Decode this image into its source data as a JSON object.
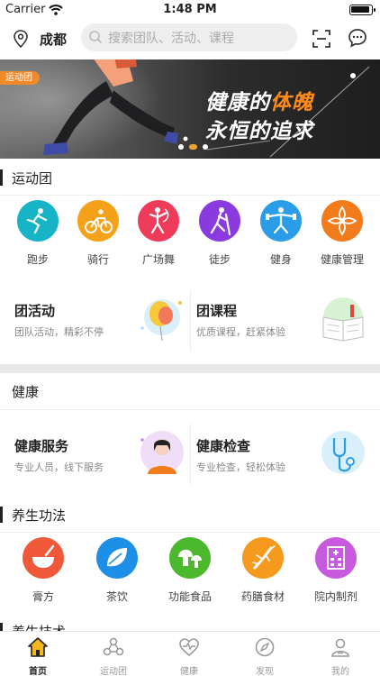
{
  "status_bar": {
    "carrier": "Carrier",
    "time": "1:48 PM"
  },
  "header": {
    "city": "成都",
    "search_placeholder": "搜索团队、活动、课程",
    "icons": [
      "location-icon",
      "search-icon",
      "scan-icon",
      "message-icon"
    ]
  },
  "banner": {
    "tag": "运动团",
    "line1_a": "健康的",
    "line1_b": "体魄",
    "line2": "永恒的追求",
    "accent_color": "#ff8a1c",
    "slide_count": 3,
    "active_slide": 2
  },
  "sections": {
    "sports": {
      "title": "运动团",
      "items": [
        {
          "label": "跑步",
          "icon": "running-icon",
          "color": "#16b4c6"
        },
        {
          "label": "骑行",
          "icon": "cycling-icon",
          "color": "#f5a21a"
        },
        {
          "label": "广场舞",
          "icon": "square-dance-icon",
          "color": "#ee3b5a"
        },
        {
          "label": "徒步",
          "icon": "hiking-icon",
          "color": "#8a3be0"
        },
        {
          "label": "健身",
          "icon": "fitness-icon",
          "color": "#2b9de8"
        },
        {
          "label": "健康管理",
          "icon": "health-management-icon",
          "color": "#f27b1c"
        }
      ],
      "cards": [
        {
          "title": "团活动",
          "subtitle": "团队活动，精彩不停"
        },
        {
          "title": "团课程",
          "subtitle": "优质课程，赶紧体验"
        }
      ]
    },
    "health": {
      "title": "健康",
      "cards": [
        {
          "title": "健康服务",
          "subtitle": "专业人员，线下服务"
        },
        {
          "title": "健康检查",
          "subtitle": "专业检查，轻松体验"
        }
      ]
    },
    "wellness": {
      "title": "养生功法",
      "items": [
        {
          "label": "膏方",
          "icon": "ointment-bowl-icon",
          "color": "#f0583a"
        },
        {
          "label": "茶饮",
          "icon": "tea-leaf-icon",
          "color": "#1e8fe6"
        },
        {
          "label": "功能食品",
          "icon": "mushroom-icon",
          "color": "#4bb82e"
        },
        {
          "label": "药膳食材",
          "icon": "ginseng-icon",
          "color": "#f59a1e"
        },
        {
          "label": "院内制剂",
          "icon": "hospital-icon",
          "color": "#c85ae0"
        }
      ]
    },
    "next": {
      "title": "养生技术"
    }
  },
  "tabbar": {
    "tabs": [
      {
        "label": "首页",
        "icon": "home-icon",
        "active": true
      },
      {
        "label": "运动团",
        "icon": "sports-group-icon",
        "active": false
      },
      {
        "label": "健康",
        "icon": "health-icon",
        "active": false
      },
      {
        "label": "发现",
        "icon": "discover-icon",
        "active": false
      },
      {
        "label": "我的",
        "icon": "profile-icon",
        "active": false
      }
    ]
  }
}
